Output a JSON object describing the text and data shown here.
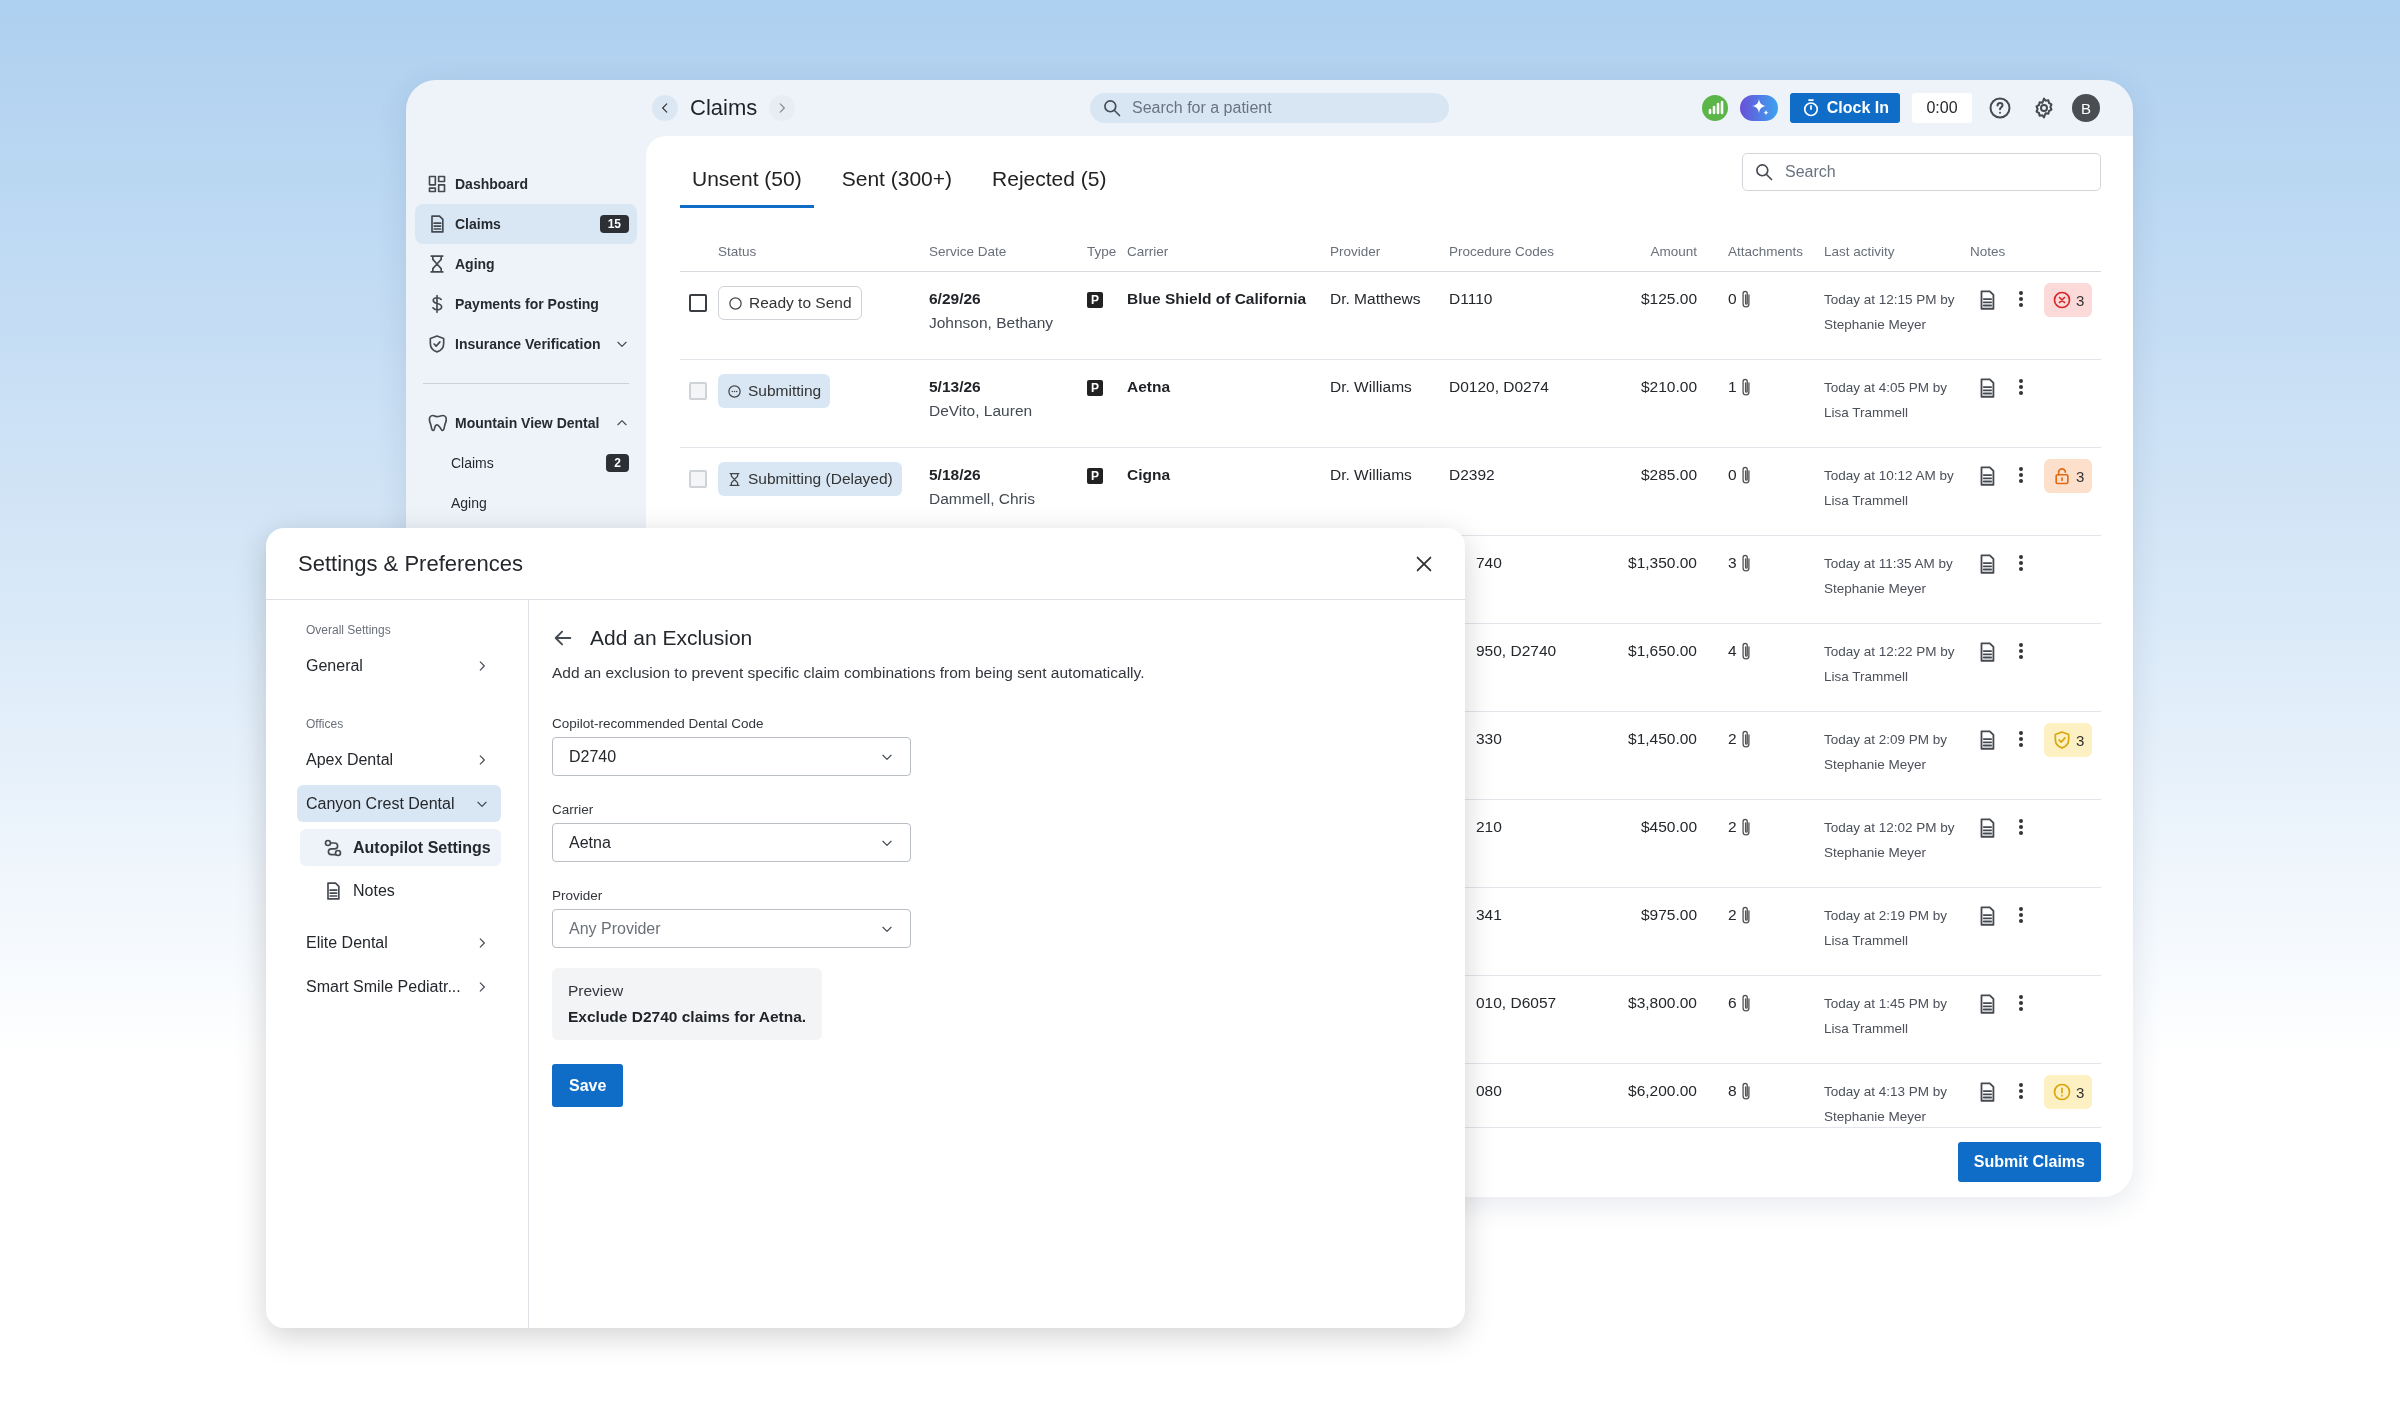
{
  "app": {
    "header": {
      "title": "Claims",
      "search": {
        "placeholder": "Search for a patient"
      },
      "clock_button": "Clock In",
      "timer": "0:00",
      "avatar": "B"
    },
    "sidebar": {
      "items": [
        {
          "label": "Dashboard",
          "selected": false
        },
        {
          "label": "Claims",
          "badge": "15",
          "selected": true
        },
        {
          "label": "Aging",
          "selected": false
        },
        {
          "label": "Payments for Posting",
          "selected": false
        },
        {
          "label": "Insurance Verification",
          "selected": false,
          "expanded": false
        }
      ],
      "offices": [
        {
          "label": "Mountain View Dental",
          "expanded": true,
          "children": [
            {
              "label": "Claims",
              "badge": "2",
              "selected": false
            },
            {
              "label": "Aging",
              "selected": false
            }
          ]
        }
      ]
    },
    "tabs": [
      {
        "label": "Unsent (50)",
        "selected": true
      },
      {
        "label": "Sent (300+)",
        "selected": false
      },
      {
        "label": "Rejected (5)",
        "selected": false
      }
    ],
    "search": {
      "placeholder": "Search"
    },
    "table": {
      "columns": [
        "Status",
        "Service Date",
        "Type",
        "Carrier",
        "Provider",
        "Procedure Codes",
        "Amount",
        "Attachments",
        "Last activity",
        "Notes"
      ],
      "rows": [
        {
          "checked": false,
          "disabled": false,
          "status": {
            "kind": "ready",
            "label": "Ready to Send"
          },
          "service_date": "6/29/26",
          "patient": "Johnson, Bethany",
          "type": "P",
          "carrier": "Blue Shield of California",
          "provider": "Dr. Matthews",
          "codes": "D1110",
          "amount": "$125.00",
          "attachments": "0",
          "activity": "Today at 12:15 PM by Stephanie Meyer",
          "alert": {
            "kind": "error",
            "count": "3"
          }
        },
        {
          "checked": false,
          "disabled": true,
          "status": {
            "kind": "submitting",
            "label": "Submitting"
          },
          "service_date": "5/13/26",
          "patient": "DeVito, Lauren",
          "type": "P",
          "carrier": "Aetna",
          "provider": "Dr. Williams",
          "codes": "D0120, D0274",
          "amount": "$210.00",
          "attachments": "1",
          "activity": "Today at 4:05 PM by Lisa Trammell"
        },
        {
          "checked": false,
          "disabled": true,
          "status": {
            "kind": "delayed",
            "label": "Submitting (Delayed)"
          },
          "service_date": "5/18/26",
          "patient": "Dammell, Chris",
          "type": "P",
          "carrier": "Cigna",
          "provider": "Dr. Williams",
          "codes": "D2392",
          "amount": "$285.00",
          "attachments": "0",
          "activity": "Today at 10:12 AM by Lisa Trammell",
          "alert": {
            "kind": "locked",
            "count": "3"
          }
        },
        {
          "codes": "740",
          "amount": "$1,350.00",
          "attachments": "3",
          "activity": "Today at 11:35 AM by Stephanie Meyer"
        },
        {
          "codes": "950, D2740",
          "amount": "$1,650.00",
          "attachments": "4",
          "activity": "Today at 12:22 PM by Lisa Trammell"
        },
        {
          "codes": "330",
          "amount": "$1,450.00",
          "attachments": "2",
          "activity": "Today at 2:09 PM by Stephanie Meyer",
          "alert": {
            "kind": "verified",
            "count": "3"
          }
        },
        {
          "codes": "210",
          "amount": "$450.00",
          "attachments": "2",
          "activity": "Today at 12:02 PM by Stephanie Meyer"
        },
        {
          "codes": "341",
          "amount": "$975.00",
          "attachments": "2",
          "activity": "Today at 2:19 PM by Lisa Trammell"
        },
        {
          "codes": "010, D6057",
          "amount": "$3,800.00",
          "attachments": "6",
          "activity": "Today at 1:45 PM by Lisa Trammell"
        },
        {
          "codes": "080",
          "amount": "$6,200.00",
          "attachments": "8",
          "activity": "Today at 4:13 PM by Stephanie Meyer",
          "alert": {
            "kind": "warning",
            "count": "3"
          }
        }
      ]
    },
    "submit_button": "Submit Claims"
  },
  "dialog": {
    "title": "Settings & Preferences",
    "nav": [
      {
        "heading": "Overall Settings",
        "items": [
          {
            "label": "General",
            "selected": false,
            "expanded": false
          }
        ]
      },
      {
        "heading": "Offices",
        "items": [
          {
            "label": "Apex Dental",
            "selected": false,
            "expanded": false
          },
          {
            "label": "Canyon Crest Dental",
            "selected": true,
            "expanded": true,
            "children": [
              {
                "label": "Autopilot Settings",
                "selected": true
              },
              {
                "label": "Notes",
                "selected": false
              }
            ]
          },
          {
            "label": "Elite Dental",
            "selected": false,
            "expanded": false
          },
          {
            "label": "Smart Smile Pediatr...",
            "selected": false,
            "expanded": false
          }
        ]
      }
    ],
    "heading": "Add an Exclusion",
    "description": "Add an exclusion to prevent specific claim combinations from being sent automatically.",
    "fields": [
      {
        "label": "Copilot-recommended Dental Code",
        "value": "D2740"
      },
      {
        "label": "Carrier",
        "value": "Aetna"
      },
      {
        "label": "Provider",
        "placeholder": "Any Provider"
      }
    ],
    "preview": {
      "label": "Preview",
      "text": "Exclude D2740 claims for Aetna."
    },
    "save_button": "Save"
  }
}
